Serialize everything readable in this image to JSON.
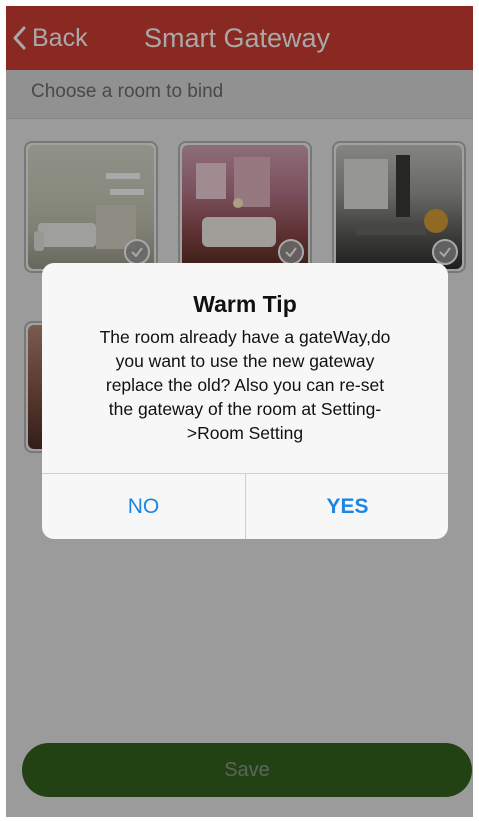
{
  "navbar": {
    "back_label": "Back",
    "title": "Smart Gateway",
    "color": "#d13f35"
  },
  "subheader": {
    "text": "Choose a room to bind"
  },
  "rooms": [
    {
      "icon": "living-room-photo",
      "checked": true
    },
    {
      "icon": "bedroom-photo",
      "checked": true
    },
    {
      "icon": "kitchen-photo",
      "checked": true
    },
    {
      "icon": "room-photo",
      "checked": false
    }
  ],
  "dialog": {
    "title": "Warm Tip",
    "message_lines": [
      "The room already have a gateWay,do",
      "you want to use the new gateway",
      "replace the old? Also you can re-set",
      "the gateway of the room at Setting-",
      ">Room Setting"
    ],
    "no_label": "NO",
    "yes_label": "YES",
    "button_color": "#1d86e3"
  },
  "footer": {
    "save_label": "Save",
    "save_color": "#4f9a2e"
  }
}
